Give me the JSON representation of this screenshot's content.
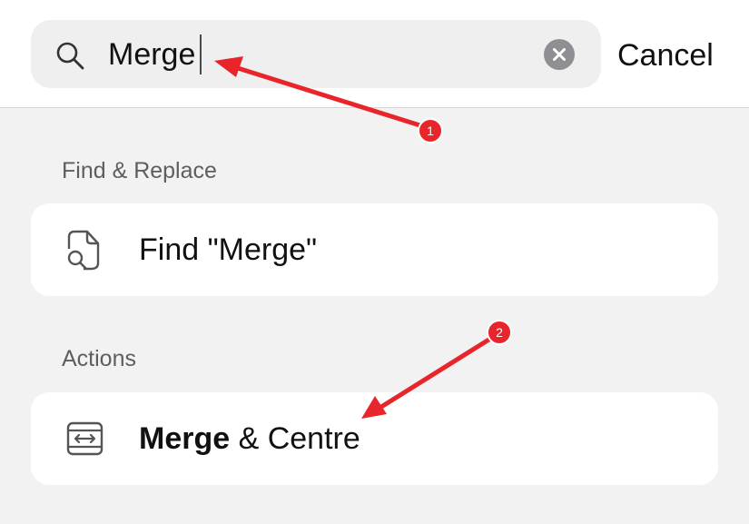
{
  "search": {
    "query": "Merge",
    "cancel_label": "Cancel"
  },
  "sections": [
    {
      "header": "Find & Replace",
      "item": {
        "label": "Find \"Merge\"",
        "icon": "document-search-icon"
      }
    },
    {
      "header": "Actions",
      "item": {
        "label_bold": "Merge",
        "label_rest": " & Centre",
        "icon": "merge-center-icon"
      }
    }
  ],
  "annotations": [
    {
      "number": "1",
      "color": "#e8252a"
    },
    {
      "number": "2",
      "color": "#e8252a"
    }
  ],
  "colors": {
    "background": "#f2f2f2",
    "card": "#ffffff",
    "search_field": "#efefef",
    "clear_button": "#8e8e93",
    "annotation": "#e8252a"
  }
}
